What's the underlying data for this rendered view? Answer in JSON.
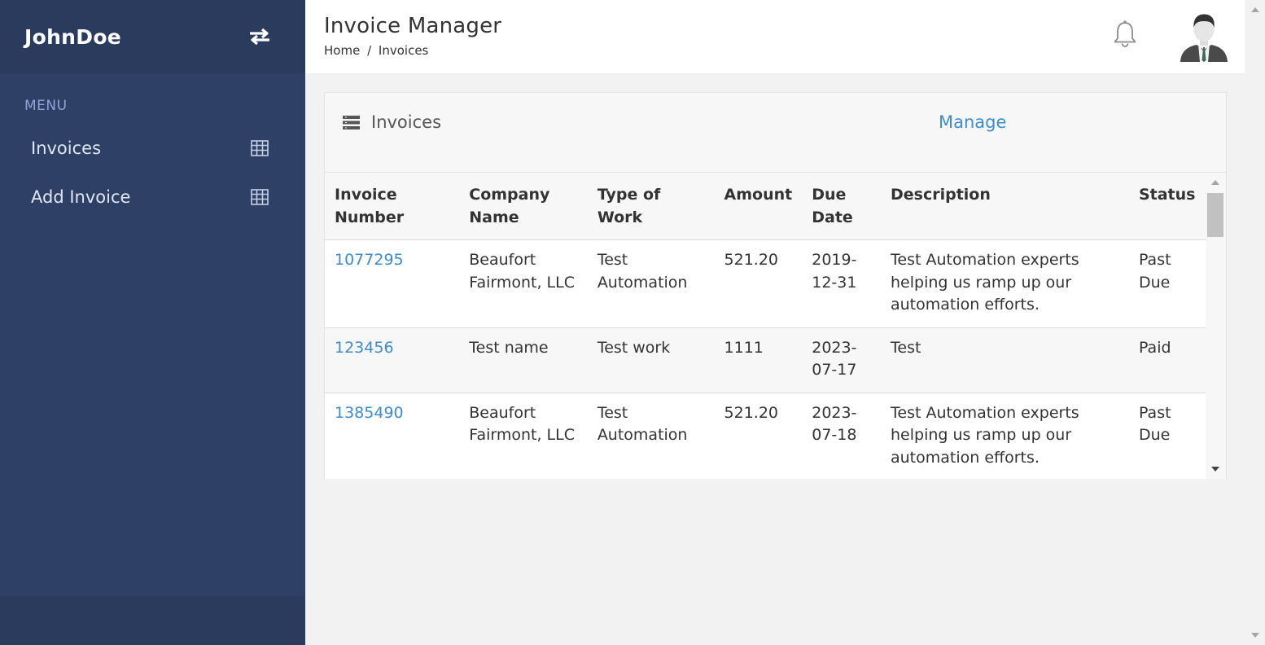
{
  "sidebar": {
    "brand": "JohnDoe",
    "menu_label": "MENU",
    "items": [
      {
        "label": "Invoices",
        "icon": "grid-icon"
      },
      {
        "label": "Add Invoice",
        "icon": "grid-icon"
      }
    ]
  },
  "header": {
    "title": "Invoice Manager",
    "breadcrumb": [
      "Home",
      "/",
      "Invoices"
    ]
  },
  "card": {
    "title": "Invoices",
    "action": "Manage"
  },
  "table": {
    "columns": [
      "Invoice Number",
      "Company Name",
      "Type of Work",
      "Amount",
      "Due Date",
      "Description",
      "Status"
    ],
    "rows": [
      {
        "invoice": "1077295",
        "company": "Beaufort Fairmont, LLC",
        "work": "Test Automation",
        "amount": "521.20",
        "due": "2019-12-31",
        "description": "Test Automation experts helping us ramp up our automation efforts.",
        "status": "Past Due"
      },
      {
        "invoice": "123456",
        "company": "Test name",
        "work": "Test work",
        "amount": "1111",
        "due": "2023-07-17",
        "description": "Test",
        "status": "Paid"
      },
      {
        "invoice": "1385490",
        "company": "Beaufort Fairmont, LLC",
        "work": "Test Automation",
        "amount": "521.20",
        "due": "2023-07-18",
        "description": "Test Automation experts helping us ramp up our automation efforts.",
        "status": "Past Due"
      }
    ]
  },
  "colors": {
    "sidebar_bg": "#2e4065",
    "sidebar_header_bg": "#2a3b5e",
    "menu_label": "#8fa3d6",
    "link": "#3c8ccf"
  }
}
